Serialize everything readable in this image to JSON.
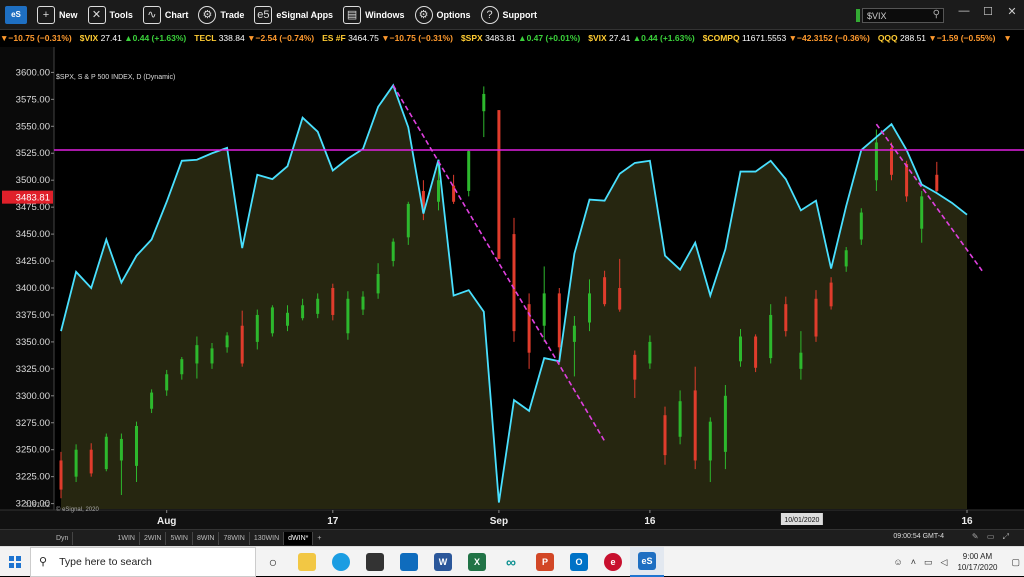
{
  "menu": {
    "items": [
      {
        "label": "New",
        "icon": "new-window-icon",
        "glyph": "+"
      },
      {
        "label": "Tools",
        "icon": "tools-icon",
        "glyph": "✕"
      },
      {
        "label": "Chart",
        "icon": "chart-icon",
        "glyph": "∿"
      },
      {
        "label": "Trade",
        "icon": "trade-icon",
        "glyph": "⚙"
      },
      {
        "label": "eSignal Apps",
        "icon": "esignal-apps-icon",
        "glyph": "e5"
      },
      {
        "label": "Windows",
        "icon": "windows-icon",
        "glyph": "▤"
      },
      {
        "label": "Options",
        "icon": "options-gear-icon",
        "glyph": "⚙"
      },
      {
        "label": "Support",
        "icon": "support-help-icon",
        "glyph": "?"
      }
    ],
    "app_logo": "eS",
    "symbol_input": "$VIX"
  },
  "ticker": [
    {
      "sym": "",
      "price": "",
      "chg": "▼−10.75 (−0.31%)",
      "dir": "dn"
    },
    {
      "sym": "$VIX",
      "price": "27.41",
      "chg": "▲0.44 (+1.63%)",
      "dir": "up"
    },
    {
      "sym": "TECL",
      "price": "338.84",
      "chg": "▼−2.54 (−0.74%)",
      "dir": "dn"
    },
    {
      "sym": "ES #F",
      "price": "3464.75",
      "chg": "▼−10.75 (−0.31%)",
      "dir": "dn"
    },
    {
      "sym": "$SPX",
      "price": "3483.81",
      "chg": "▲0.47 (+0.01%)",
      "dir": "up"
    },
    {
      "sym": "$VIX",
      "price": "27.41",
      "chg": "▲0.44 (+1.63%)",
      "dir": "up"
    },
    {
      "sym": "$COMPQ",
      "price": "11671.5553",
      "chg": "▼−42.3152 (−0.36%)",
      "dir": "dn"
    },
    {
      "sym": "QQQ",
      "price": "288.51",
      "chg": "▼−1.59 (−0.55%)",
      "dir": "dn"
    },
    {
      "sym": "",
      "price": "",
      "chg": "▼",
      "dir": "dn"
    }
  ],
  "chart_data": {
    "type": "line",
    "title": "$SPX, S & P 500 INDEX, D (Dynamic)",
    "ylim": [
      3181.02,
      3600
    ],
    "y_ticks": [
      3200,
      3225,
      3250,
      3275,
      3300,
      3325,
      3350,
      3375,
      3400,
      3425,
      3450,
      3475,
      3500,
      3525,
      3550,
      3575,
      3600
    ],
    "y_bottom_label": "3181.02",
    "last_price_label": "3483.81",
    "x_ticks": [
      {
        "label": "Aug",
        "i": 7
      },
      {
        "label": "17",
        "i": 18
      },
      {
        "label": "Sep",
        "i": 29
      },
      {
        "label": "16",
        "i": 39
      },
      {
        "label": "10/01/2020",
        "i": 49
      },
      {
        "label": "16",
        "i": 60
      }
    ],
    "oscillator_series": {
      "name": "cyan line",
      "values": [
        3360,
        3415,
        3400,
        3445,
        3405,
        3430,
        3445,
        3480,
        3518,
        3519,
        3525,
        3530,
        3437,
        3505,
        3501,
        3513,
        3558,
        3545,
        3509,
        3520,
        3529,
        3568,
        3588,
        3549,
        3469,
        3519,
        3393,
        3398,
        3378,
        3201,
        3296,
        3286,
        3335,
        3332,
        3432,
        3482,
        3481,
        3506,
        3516,
        3518,
        3430,
        3417,
        3442,
        3393,
        3436,
        3508,
        3508,
        3518,
        3501,
        3472,
        3481,
        3418,
        3476,
        3528,
        3540,
        3552,
        3528,
        3496,
        3488,
        3479,
        3468
      ]
    },
    "candles": [
      {
        "i": 0,
        "o": 3213,
        "c": 3240,
        "h": 3248,
        "l": 3205,
        "dir": "down"
      },
      {
        "i": 1,
        "o": 3225,
        "c": 3250,
        "h": 3255,
        "l": 3220,
        "dir": "up"
      },
      {
        "i": 2,
        "o": 3250,
        "c": 3228,
        "h": 3256,
        "l": 3225,
        "dir": "down"
      },
      {
        "i": 3,
        "o": 3232,
        "c": 3262,
        "h": 3265,
        "l": 3230,
        "dir": "up"
      },
      {
        "i": 4,
        "o": 3240,
        "c": 3260,
        "h": 3265,
        "l": 3208,
        "dir": "up"
      },
      {
        "i": 5,
        "o": 3235,
        "c": 3272,
        "h": 3276,
        "l": 3220,
        "dir": "up"
      },
      {
        "i": 6,
        "o": 3288,
        "c": 3303,
        "h": 3306,
        "l": 3284,
        "dir": "up"
      },
      {
        "i": 7,
        "o": 3305,
        "c": 3320,
        "h": 3324,
        "l": 3300,
        "dir": "up"
      },
      {
        "i": 8,
        "o": 3320,
        "c": 3334,
        "h": 3336,
        "l": 3315,
        "dir": "up"
      },
      {
        "i": 9,
        "o": 3330,
        "c": 3347,
        "h": 3355,
        "l": 3316,
        "dir": "up"
      },
      {
        "i": 10,
        "o": 3330,
        "c": 3344,
        "h": 3349,
        "l": 3325,
        "dir": "up"
      },
      {
        "i": 11,
        "o": 3345,
        "c": 3356,
        "h": 3359,
        "l": 3340,
        "dir": "up"
      },
      {
        "i": 12,
        "o": 3365,
        "c": 3330,
        "h": 3379,
        "l": 3327,
        "dir": "down"
      },
      {
        "i": 13,
        "o": 3350,
        "c": 3375,
        "h": 3380,
        "l": 3343,
        "dir": "up"
      },
      {
        "i": 14,
        "o": 3358,
        "c": 3382,
        "h": 3384,
        "l": 3355,
        "dir": "up"
      },
      {
        "i": 15,
        "o": 3365,
        "c": 3377,
        "h": 3384,
        "l": 3360,
        "dir": "up"
      },
      {
        "i": 16,
        "o": 3372,
        "c": 3384,
        "h": 3390,
        "l": 3370,
        "dir": "up"
      },
      {
        "i": 17,
        "o": 3376,
        "c": 3390,
        "h": 3395,
        "l": 3372,
        "dir": "up"
      },
      {
        "i": 18,
        "o": 3400,
        "c": 3375,
        "h": 3404,
        "l": 3370,
        "dir": "down"
      },
      {
        "i": 19,
        "o": 3358,
        "c": 3390,
        "h": 3397,
        "l": 3352,
        "dir": "up"
      },
      {
        "i": 20,
        "o": 3380,
        "c": 3392,
        "h": 3397,
        "l": 3375,
        "dir": "up"
      },
      {
        "i": 21,
        "o": 3395,
        "c": 3413,
        "h": 3423,
        "l": 3390,
        "dir": "up"
      },
      {
        "i": 22,
        "o": 3425,
        "c": 3443,
        "h": 3446,
        "l": 3420,
        "dir": "up"
      },
      {
        "i": 23,
        "o": 3447,
        "c": 3478,
        "h": 3480,
        "l": 3440,
        "dir": "up"
      },
      {
        "i": 24,
        "o": 3490,
        "c": 3470,
        "h": 3500,
        "l": 3463,
        "dir": "down"
      },
      {
        "i": 25,
        "o": 3480,
        "c": 3500,
        "h": 3514,
        "l": 3472,
        "dir": "up"
      },
      {
        "i": 26,
        "o": 3495,
        "c": 3480,
        "h": 3505,
        "l": 3478,
        "dir": "down"
      },
      {
        "i": 27,
        "o": 3490,
        "c": 3527,
        "h": 3528,
        "l": 3485,
        "dir": "up"
      },
      {
        "i": 28,
        "o": 3564,
        "c": 3580,
        "h": 3587,
        "l": 3540,
        "dir": "up"
      },
      {
        "i": 29,
        "o": 3565,
        "c": 3427,
        "h": 3565,
        "l": 3427,
        "dir": "down"
      },
      {
        "i": 30,
        "o": 3450,
        "c": 3360,
        "h": 3465,
        "l": 3350,
        "dir": "down"
      },
      {
        "i": 31,
        "o": 3385,
        "c": 3340,
        "h": 3395,
        "l": 3325,
        "dir": "down"
      },
      {
        "i": 32,
        "o": 3365,
        "c": 3395,
        "h": 3420,
        "l": 3350,
        "dir": "up"
      },
      {
        "i": 33,
        "o": 3395,
        "c": 3345,
        "h": 3400,
        "l": 3330,
        "dir": "down"
      },
      {
        "i": 34,
        "o": 3350,
        "c": 3365,
        "h": 3374,
        "l": 3318,
        "dir": "up"
      },
      {
        "i": 35,
        "o": 3368,
        "c": 3395,
        "h": 3408,
        "l": 3360,
        "dir": "up"
      },
      {
        "i": 36,
        "o": 3410,
        "c": 3385,
        "h": 3416,
        "l": 3383,
        "dir": "down"
      },
      {
        "i": 37,
        "o": 3400,
        "c": 3380,
        "h": 3427,
        "l": 3378,
        "dir": "down"
      },
      {
        "i": 38,
        "o": 3338,
        "c": 3315,
        "h": 3342,
        "l": 3298,
        "dir": "down"
      },
      {
        "i": 39,
        "o": 3330,
        "c": 3350,
        "h": 3356,
        "l": 3325,
        "dir": "up"
      },
      {
        "i": 40,
        "o": 3282,
        "c": 3245,
        "h": 3290,
        "l": 3236,
        "dir": "down"
      },
      {
        "i": 41,
        "o": 3262,
        "c": 3295,
        "h": 3305,
        "l": 3255,
        "dir": "up"
      },
      {
        "i": 42,
        "o": 3305,
        "c": 3240,
        "h": 3327,
        "l": 3232,
        "dir": "down"
      },
      {
        "i": 43,
        "o": 3240,
        "c": 3276,
        "h": 3280,
        "l": 3220,
        "dir": "up"
      },
      {
        "i": 44,
        "o": 3248,
        "c": 3300,
        "h": 3310,
        "l": 3232,
        "dir": "up"
      },
      {
        "i": 45,
        "o": 3332,
        "c": 3355,
        "h": 3362,
        "l": 3327,
        "dir": "up"
      },
      {
        "i": 46,
        "o": 3355,
        "c": 3326,
        "h": 3357,
        "l": 3322,
        "dir": "down"
      },
      {
        "i": 47,
        "o": 3335,
        "c": 3375,
        "h": 3385,
        "l": 3330,
        "dir": "up"
      },
      {
        "i": 48,
        "o": 3385,
        "c": 3360,
        "h": 3392,
        "l": 3355,
        "dir": "down"
      },
      {
        "i": 49,
        "o": 3325,
        "c": 3340,
        "h": 3360,
        "l": 3315,
        "dir": "up"
      },
      {
        "i": 50,
        "o": 3390,
        "c": 3355,
        "h": 3398,
        "l": 3350,
        "dir": "down"
      },
      {
        "i": 51,
        "o": 3405,
        "c": 3383,
        "h": 3410,
        "l": 3380,
        "dir": "down"
      },
      {
        "i": 52,
        "o": 3420,
        "c": 3435,
        "h": 3438,
        "l": 3415,
        "dir": "up"
      },
      {
        "i": 53,
        "o": 3445,
        "c": 3470,
        "h": 3474,
        "l": 3440,
        "dir": "up"
      },
      {
        "i": 54,
        "o": 3535,
        "c": 3500,
        "h": 3547,
        "l": 3490,
        "dir": "up"
      },
      {
        "i": 55,
        "o": 3530,
        "c": 3505,
        "h": 3535,
        "l": 3500,
        "dir": "down"
      },
      {
        "i": 56,
        "o": 3515,
        "c": 3485,
        "h": 3518,
        "l": 3480,
        "dir": "down"
      },
      {
        "i": 57,
        "o": 3455,
        "c": 3485,
        "h": 3490,
        "l": 3442,
        "dir": "up"
      },
      {
        "i": 58,
        "o": 3505,
        "c": 3490,
        "h": 3517,
        "l": 3488,
        "dir": "down"
      }
    ],
    "horizontal_line": {
      "y": 3528,
      "color": "#e020e0"
    },
    "trendlines": [
      {
        "from": {
          "i": 22,
          "y": 3588
        },
        "to": {
          "i": 36,
          "y": 3258
        },
        "color": "#e040e0"
      },
      {
        "from": {
          "i": 54,
          "y": 3552
        },
        "to": {
          "i": 61,
          "y": 3416
        },
        "color": "#e040e0"
      }
    ],
    "colors": {
      "line": "#49e0ff",
      "fill": "#2a2a12",
      "up": "#2db82d",
      "down": "#e03c2c",
      "grid": "#1a1a1a",
      "tag": "#e0202a"
    },
    "copyright": "© eSignal, 2020"
  },
  "footer": {
    "mode_label": "Dyn",
    "timeframes": [
      "1WIN",
      "2WIN",
      "5WIN",
      "8WIN",
      "78WIN",
      "130WIN",
      "dWIN*"
    ],
    "add": "+",
    "time": "09:00:54 GMT-4"
  },
  "taskbar": {
    "search_placeholder": "Type here to search",
    "time": "9:00 AM",
    "date": "10/17/2020"
  }
}
